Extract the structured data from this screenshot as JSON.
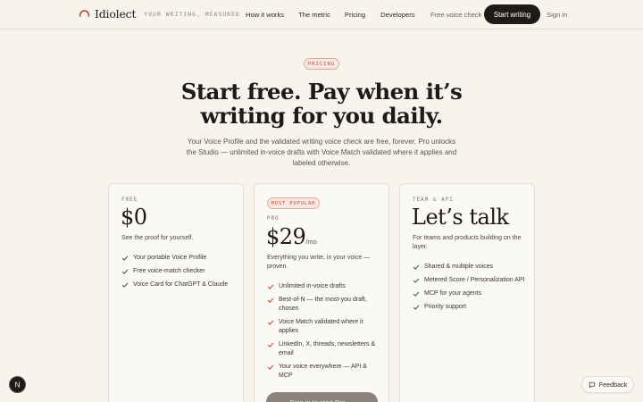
{
  "header": {
    "brand_name": "Idiolect",
    "brand_tagline": "YOUR WRITING, MEASURED",
    "brand_icon": "arc-logo-icon",
    "accent_color": "#c0503a",
    "nav": [
      {
        "label": "How it works"
      },
      {
        "label": "The metric"
      },
      {
        "label": "Pricing"
      },
      {
        "label": "Developers"
      }
    ],
    "free_voice_check": "Free voice check",
    "start_writing": "Start writing",
    "sign_in": "Sign in"
  },
  "hero": {
    "eyebrow": "PRICING",
    "headline_line1": "Start free. Pay when it’s",
    "headline_line2": "writing for you daily.",
    "subhead": "Your Voice Profile and the validated writing voice check are free, forever. Pro unlocks the Studio — unlimited in-voice drafts with Voice Match validated where it applies and labeled otherwise."
  },
  "plans": [
    {
      "tier": "FREE",
      "price": "$0",
      "description": "See the proof for yourself.",
      "check_icon": "check-icon",
      "features": [
        "Your portable Voice Profile",
        "Free voice-match checker",
        "Voice Card for ChatGPT & Claude"
      ]
    },
    {
      "badge": "MOST POPULAR",
      "tier": "PRO",
      "price": "$29",
      "per": "/mo",
      "description": "Everything you write, in your voice — proven.",
      "check_icon": "check-icon",
      "features": [
        "Unlimited in-voice drafts",
        "Best-of-N — the most-you draft, chosen",
        "Voice Match validated where it applies",
        "LinkedIn, X, threads, newsletters & email",
        "Your voice everywhere — API & MCP"
      ],
      "cta": "Sign in to start Pro →"
    },
    {
      "tier": "TEAM & API",
      "price": "Let’s talk",
      "description": "For teams and products building on the layer.",
      "check_icon": "check-icon",
      "features": [
        "Shared & multiple voices",
        "Metered Score / Personalization API",
        "MCP for your agents",
        "Priority support"
      ]
    }
  ],
  "floating": {
    "avatar_initial": "N",
    "feedback_label": "Feedback",
    "feedback_icon": "chat-bubble-icon"
  }
}
